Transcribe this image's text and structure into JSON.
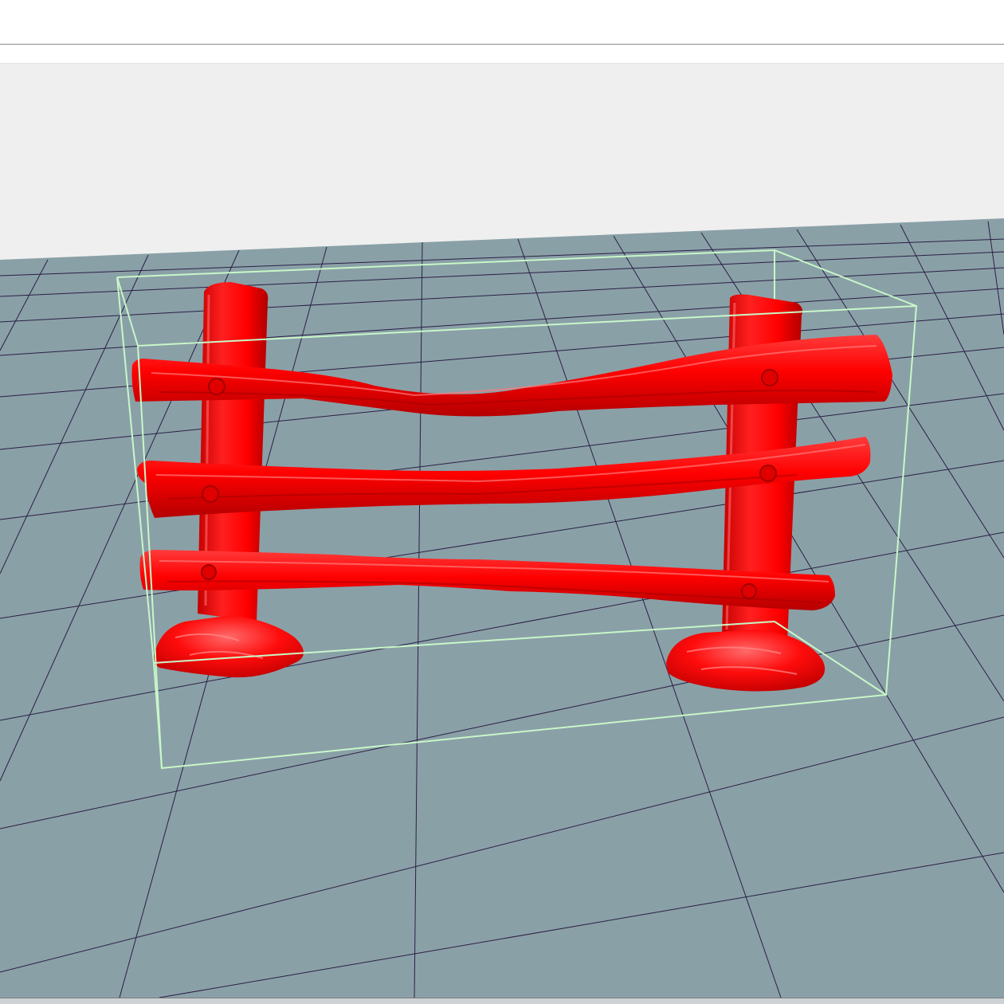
{
  "viewport": {
    "sky_color": "#efefef",
    "ground_color": "#8aa0a7",
    "grid_line_color": "#2a1f45",
    "bounding_box_color": "#c8f7c8",
    "model_color": "#ff0000",
    "model_shadow_color": "#b30000",
    "model_highlight_color": "#ff6a6a",
    "model": {
      "posts": 2,
      "rails": 3,
      "bases": 2
    }
  }
}
